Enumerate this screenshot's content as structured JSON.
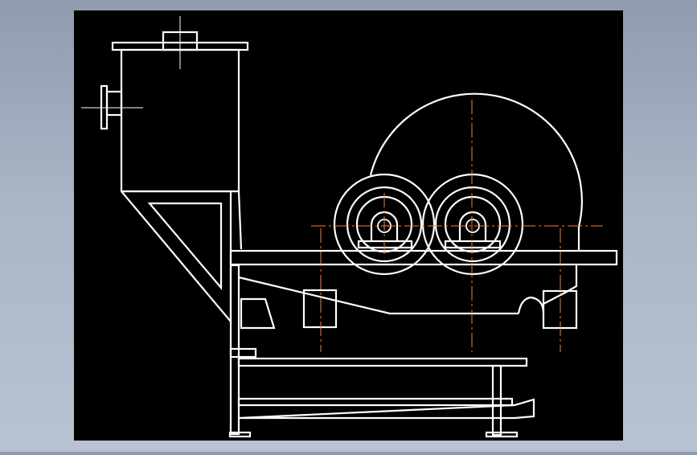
{
  "viewport": {
    "background": "#000000",
    "frame_bg": "#a9b6c6",
    "line_color": "#ffffff",
    "centerline_color": "#ff7b35"
  }
}
